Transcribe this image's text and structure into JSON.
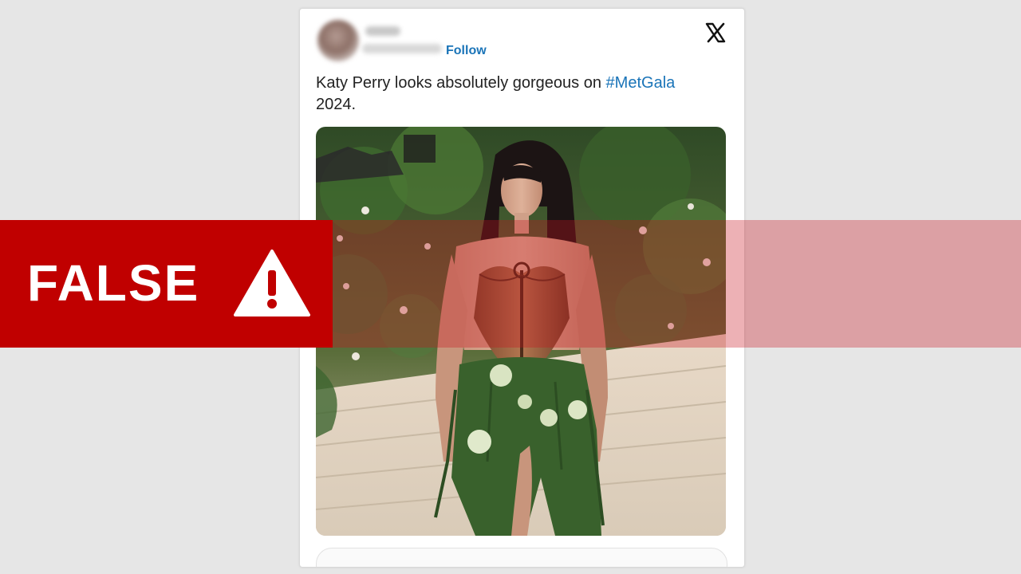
{
  "post": {
    "follow_label": "Follow",
    "text_before_hashtag": "Katy Perry looks absolutely gorgeous on ",
    "hashtag": "#MetGala",
    "text_after_hashtag": "2024.",
    "platform_icon": "x-logo-icon"
  },
  "verdict": {
    "label": "FALSE",
    "icon": "warning-triangle-icon",
    "band_color": "#c00000"
  },
  "colors": {
    "link": "#1a74b8",
    "background": "#e6e6e6"
  }
}
